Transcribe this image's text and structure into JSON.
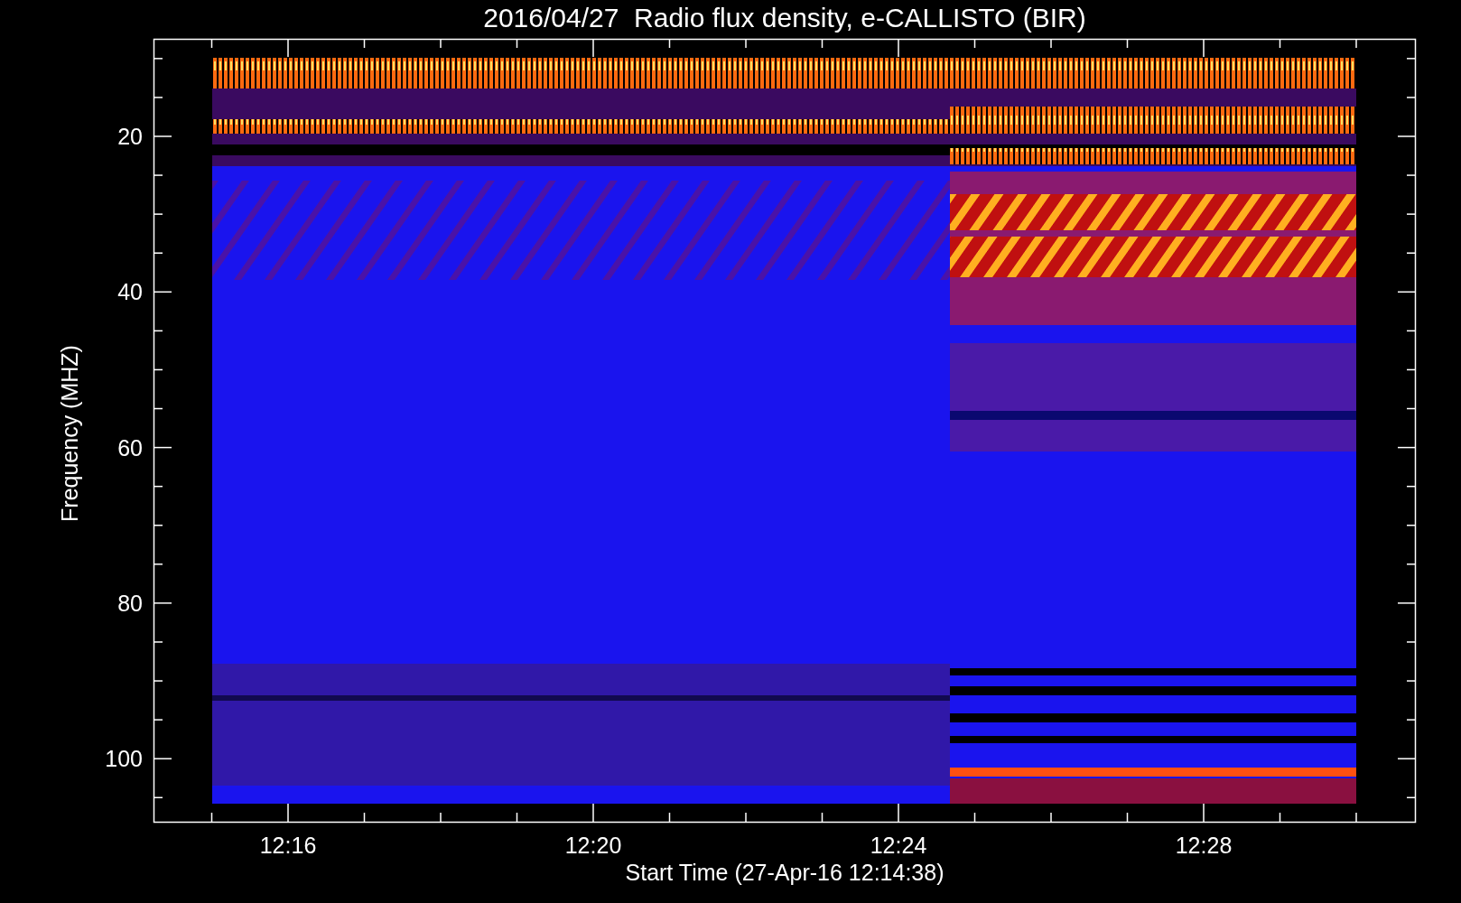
{
  "title": "2016/04/27  Radio flux density, e-CALLISTO (BIR)",
  "y_axis": {
    "label": "Frequency (MHZ)",
    "ticks": [
      "20",
      "40",
      "60",
      "80",
      "100"
    ]
  },
  "x_axis": {
    "label": "Start Time (27-Apr-16 12:14:38)",
    "ticks": [
      "12:16",
      "12:20",
      "12:24",
      "12:28"
    ]
  }
}
